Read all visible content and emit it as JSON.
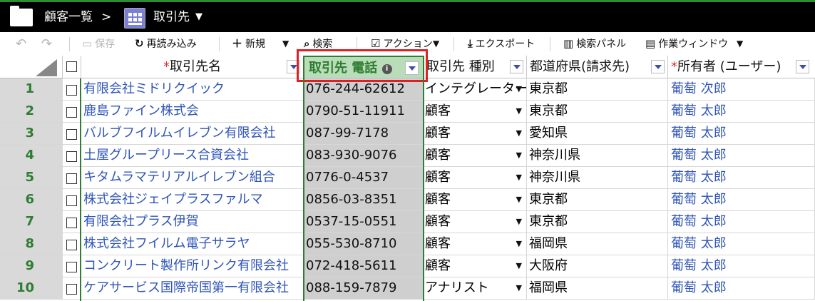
{
  "titlebar": {
    "breadcrumb_root": "顧客一覧",
    "separator": ">",
    "current": "取引先",
    "folder_icon": "folder-icon",
    "app_icon": "grid-building-icon",
    "dropdown_glyph": "▼"
  },
  "toolbar": {
    "undo_icon": "undo-icon",
    "redo_icon": "redo-icon",
    "save_label": "保存",
    "reload_label": "再読み込み",
    "new_label": "新規",
    "search_label": "検索",
    "action_label": "アクション",
    "export_label": "エクスポート",
    "search_panel_label": "検索パネル",
    "work_window_label": "作業ウィンドウ"
  },
  "columns": {
    "name": "取引先名",
    "phone": "取引先 電話",
    "type": "取引先 種別",
    "prefecture": "都道府県(請求先)",
    "owner": "所有者 (ユーザー)",
    "required_mark": "*",
    "info_icon": "info-icon"
  },
  "rows": [
    {
      "num": "1",
      "name": "有限会社ミドリクイック",
      "phone": "076-244-62612",
      "type": "インテグレーター",
      "pref": "東京都",
      "owner": "葡萄 次郎"
    },
    {
      "num": "2",
      "name": "鹿島ファイン株式会",
      "phone": "0790-51-11911",
      "type": "顧客",
      "pref": "東京都",
      "owner": "葡萄 太郎"
    },
    {
      "num": "3",
      "name": "バルブフイルムイレブン有限会社",
      "phone": "087-99-7178",
      "type": "顧客",
      "pref": "愛知県",
      "owner": "葡萄 太郎"
    },
    {
      "num": "4",
      "name": "土屋グループリース合資会社",
      "phone": "083-930-9076",
      "type": "顧客",
      "pref": "神奈川県",
      "owner": "葡萄 太郎"
    },
    {
      "num": "5",
      "name": "キタムラマテリアルイレブン組合",
      "phone": "0776-0-4537",
      "type": "顧客",
      "pref": "神奈川県",
      "owner": "葡萄 太郎"
    },
    {
      "num": "6",
      "name": "株式会社ジェイプラスファルマ",
      "phone": "0856-03-8351",
      "type": "顧客",
      "pref": "東京都",
      "owner": "葡萄 太郎"
    },
    {
      "num": "7",
      "name": "有限会社プラス伊賀",
      "phone": "0537-15-0551",
      "type": "顧客",
      "pref": "東京都",
      "owner": "葡萄 太郎"
    },
    {
      "num": "8",
      "name": "株式会社フイルム電子サラヤ",
      "phone": "055-530-8710",
      "type": "顧客",
      "pref": "福岡県",
      "owner": "葡萄 太郎"
    },
    {
      "num": "9",
      "name": "コンクリート製作所リンク有限会社",
      "phone": "072-418-5611",
      "type": "顧客",
      "pref": "大阪府",
      "owner": "葡萄 太郎"
    },
    {
      "num": "10",
      "name": "ケアサービス国際帝国第一有限会社",
      "phone": "088-159-7879",
      "type": "アナリスト",
      "pref": "福岡県",
      "owner": "葡萄 太郎"
    }
  ],
  "colors": {
    "accent_green": "#2e7d32",
    "link_blue": "#2f55b8",
    "highlight_red": "#e02020",
    "required_red": "#e03030"
  }
}
